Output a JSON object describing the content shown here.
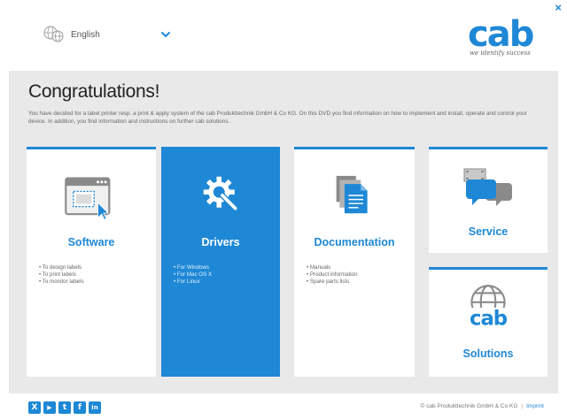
{
  "header": {
    "language": {
      "selected": "English"
    },
    "logo": {
      "wordmark": "cab",
      "tagline": "we identify success"
    },
    "close_symbol": "×"
  },
  "main": {
    "heading": "Congratulations!",
    "intro": "You have decided for a label printer resp. a print & apply system of the cab Produkttechnik GmbH & Co KG. On this DVD you find information on how to implement and install, operate and control your device. In addition, you find information and instructions on further cab solutions."
  },
  "cards": {
    "software": {
      "title": "Software",
      "icon": "window-cursor-icon",
      "items": [
        "To design labels",
        "To print labels",
        "To monitor labels"
      ]
    },
    "drivers": {
      "title": "Drivers",
      "icon": "gear-wrench-icon",
      "items": [
        "For Windows",
        "For Mac OS X",
        "For Linux"
      ]
    },
    "documentation": {
      "title": "Documentation",
      "icon": "documents-icon",
      "items": [
        "Manuals",
        "Product information",
        "Spare parts lists"
      ]
    },
    "service": {
      "title": "Service",
      "icon": "chat-bubbles-icon"
    },
    "solutions": {
      "title": "Solutions",
      "icon": "globe-cab-icon",
      "mark": "cab"
    }
  },
  "footer": {
    "social": [
      "xing-icon",
      "youtube-icon",
      "twitter-icon",
      "facebook-icon",
      "linkedin-icon"
    ],
    "social_glyphs": [
      "X",
      "▶",
      "t",
      "f",
      "in"
    ],
    "copyright": "© cab Produkttechnik GmbH & Co KG",
    "separator": "|",
    "imprint": "Imprint"
  },
  "colors": {
    "accent": "#1e88d6",
    "background": "#e9e9e9"
  }
}
